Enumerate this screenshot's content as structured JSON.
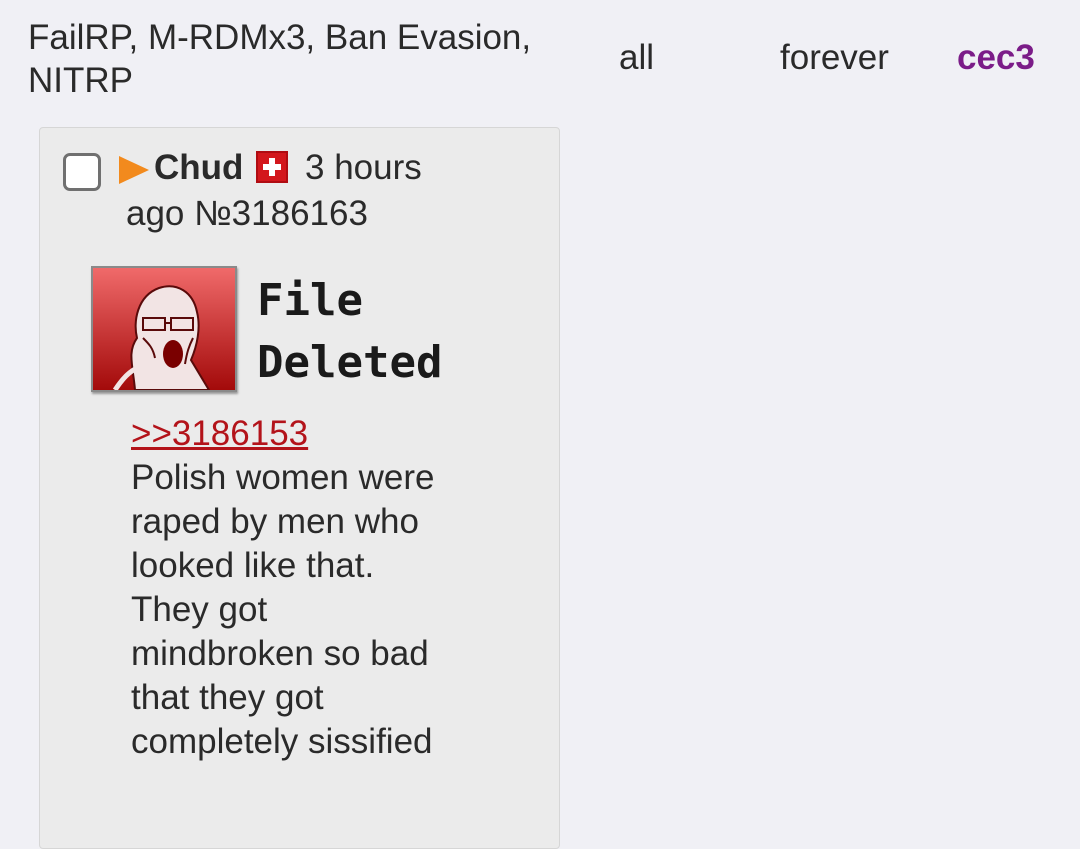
{
  "ban": {
    "reason": "FailRP, M-RDMx3, Ban Evasion, NITRP",
    "scope": "all",
    "duration": "forever",
    "moderator": "cec3"
  },
  "post": {
    "name": "Chud",
    "flag_icon": "swiss-flag-icon",
    "time_part1": "3 hours",
    "time_part2": "ago",
    "post_number": "№3186163",
    "file_status": "File Deleted",
    "quote_link": ">>3186153",
    "body": "Polish women were raped by men who looked like that. They got mindbroken so bad that they got completely sissified"
  },
  "colors": {
    "accent_mod": "#7b1c88",
    "quote_link": "#b3131a",
    "arrow": "#f28a1d",
    "flag": "#d3171c"
  }
}
